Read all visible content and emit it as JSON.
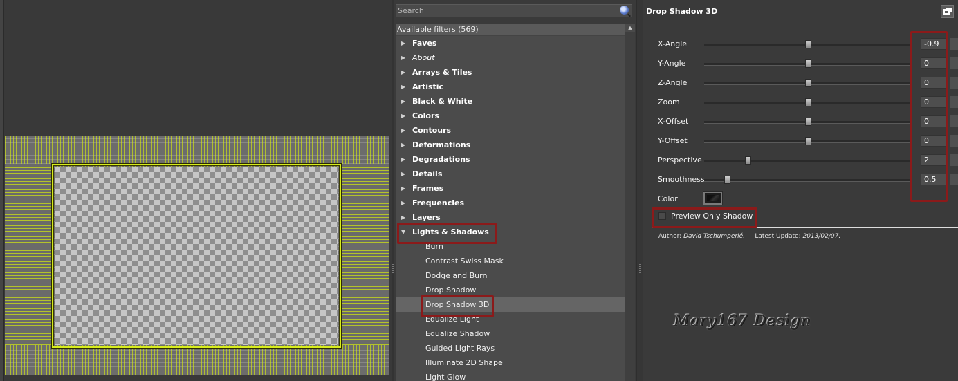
{
  "search": {
    "placeholder": "Search",
    "value": ""
  },
  "filters": {
    "header": "Available filters (569)",
    "rows": [
      {
        "label": "Faves",
        "kind": "cat"
      },
      {
        "label": "About",
        "kind": "italic"
      },
      {
        "label": "Arrays & Tiles",
        "kind": "cat"
      },
      {
        "label": "Artistic",
        "kind": "cat"
      },
      {
        "label": "Black & White",
        "kind": "cat"
      },
      {
        "label": "Colors",
        "kind": "cat"
      },
      {
        "label": "Contours",
        "kind": "cat"
      },
      {
        "label": "Deformations",
        "kind": "cat"
      },
      {
        "label": "Degradations",
        "kind": "cat"
      },
      {
        "label": "Details",
        "kind": "cat"
      },
      {
        "label": "Frames",
        "kind": "cat"
      },
      {
        "label": "Frequencies",
        "kind": "cat"
      },
      {
        "label": "Layers",
        "kind": "cat"
      },
      {
        "label": "Lights & Shadows",
        "kind": "cat-open"
      },
      {
        "label": "Burn",
        "kind": "sub"
      },
      {
        "label": "Contrast Swiss Mask",
        "kind": "sub"
      },
      {
        "label": "Dodge and Burn",
        "kind": "sub"
      },
      {
        "label": "Drop Shadow",
        "kind": "sub"
      },
      {
        "label": "Drop Shadow 3D",
        "kind": "sub-selected"
      },
      {
        "label": "Equalize Light",
        "kind": "sub"
      },
      {
        "label": "Equalize Shadow",
        "kind": "sub"
      },
      {
        "label": "Guided Light Rays",
        "kind": "sub"
      },
      {
        "label": "Illuminate 2D Shape",
        "kind": "sub"
      },
      {
        "label": "Light Glow",
        "kind": "sub"
      }
    ]
  },
  "params": {
    "title": "Drop Shadow 3D",
    "sliders": [
      {
        "label": "X-Angle",
        "value": "-0.9",
        "fraction": 0.5
      },
      {
        "label": "Y-Angle",
        "value": "0",
        "fraction": 0.5
      },
      {
        "label": "Z-Angle",
        "value": "0",
        "fraction": 0.5
      },
      {
        "label": "Zoom",
        "value": "0",
        "fraction": 0.5
      },
      {
        "label": "X-Offset",
        "value": "0",
        "fraction": 0.5
      },
      {
        "label": "Y-Offset",
        "value": "0",
        "fraction": 0.5
      },
      {
        "label": "Perspective",
        "value": "2",
        "fraction": 0.21
      },
      {
        "label": "Smoothness",
        "value": "0.5",
        "fraction": 0.11
      }
    ],
    "color_label": "Color",
    "color_value": "#1c1c1c",
    "preview_only_shadow_label": "Preview Only Shadow",
    "author_prefix": "Author:",
    "author_name": "David Tschumperlé.",
    "update_prefix": "Latest Update:",
    "update_date": "2013/02/07."
  },
  "watermark": "Mary167 Design",
  "colors": {
    "highlight": "#8b1a1a",
    "frame_yellow": "#d7ec1e"
  }
}
